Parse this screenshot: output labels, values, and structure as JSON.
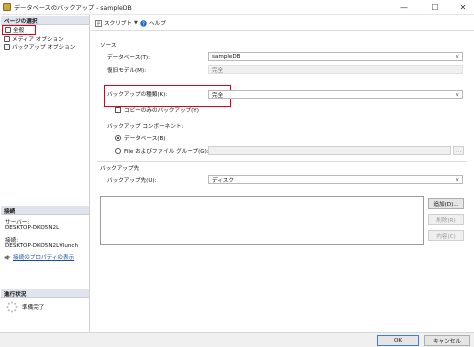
{
  "window": {
    "title": "データベースのバックアップ - sampleDB",
    "minimize_glyph": "—",
    "maximize_glyph": "☐",
    "close_glyph": "✕"
  },
  "sidebar": {
    "page_select_header": "ページの選択",
    "items": [
      {
        "label": "全般",
        "icon": "page-icon",
        "selected": true
      },
      {
        "label": "メディア オプション",
        "icon": "page-icon"
      },
      {
        "label": "バックアップ オプション",
        "icon": "page-icon"
      }
    ],
    "connection_header": "接続",
    "server_label": "サーバー:",
    "server_value": "DESKTOP-DKO5N2L",
    "connection_label": "接続:",
    "connection_value": "DESKTOP-DKO5N2L¥lunch",
    "connection_link": "接続のプロパティの表示",
    "progress_header": "進行状況",
    "progress_status": "準備完了"
  },
  "toolbar": {
    "script_label": "スクリプト",
    "help_label": "ヘルプ"
  },
  "source": {
    "section_label": "ソース",
    "database_label": "データベース(T):",
    "database_value": "sampleDB",
    "recovery_label": "復旧モデル(M):",
    "recovery_value": "完全",
    "backup_type_label": "バックアップの種類(K):",
    "backup_type_value": "完全",
    "copy_only_label": "コピーのみのバックアップ(Y)",
    "component_label": "バックアップ コンポーネント:",
    "component_options": [
      {
        "label": "データベース(B)",
        "selected": true
      },
      {
        "label": "File およびファイル グループ(G):",
        "selected": false
      }
    ]
  },
  "destination": {
    "section_label": "バックアップ先",
    "backup_to_label": "バックアップ先(U):",
    "backup_to_value": "ディスク",
    "add_button": "追加(D)...",
    "remove_button": "削除(R)",
    "contents_button": "内容(C)"
  },
  "footer": {
    "ok_button": "OK",
    "cancel_button": "キャンセル"
  },
  "colors": {
    "highlight_red": "#e0001a",
    "section_header_bg": "#dfe4ee",
    "link_blue": "#1a4fa8"
  }
}
